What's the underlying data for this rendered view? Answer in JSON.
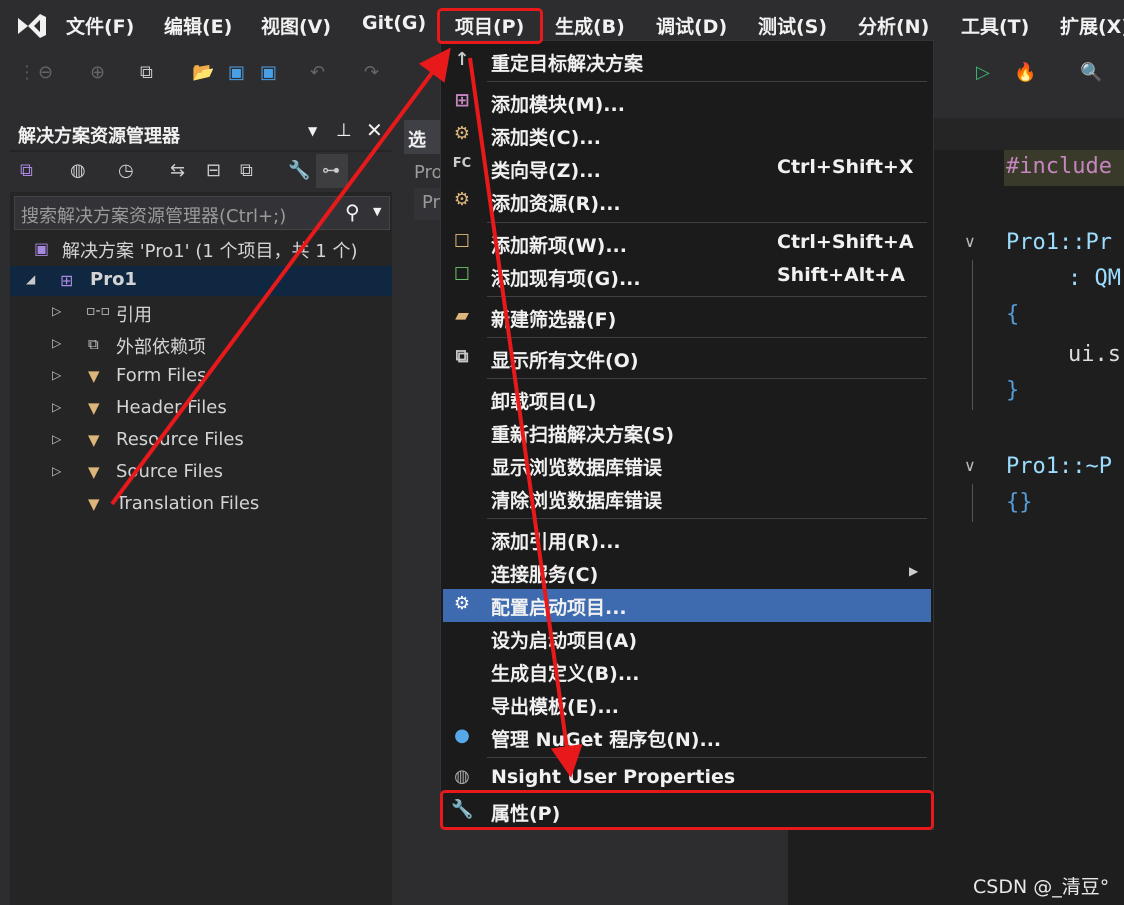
{
  "menubar": {
    "items": [
      "文件(F)",
      "编辑(E)",
      "视图(V)",
      "Git(G)",
      "项目(P)",
      "生成(B)",
      "调试(D)",
      "测试(S)",
      "分析(N)",
      "工具(T)",
      "扩展(X)"
    ]
  },
  "solution_explorer": {
    "title": "解决方案资源管理器",
    "search_placeholder": "搜索解决方案资源管理器(Ctrl+;)",
    "solution": "解决方案 'Pro1' (1 个项目，共 1 个)",
    "project": "Pro1",
    "nodes": [
      "引用",
      "外部依赖项",
      "Form Files",
      "Header Files",
      "Resource Files",
      "Source Files",
      "Translation Files"
    ]
  },
  "middle_panel": {
    "tab": "选",
    "line1": "Pro",
    "line2": "Pr"
  },
  "editor": {
    "lines": [
      "#include",
      "Pro1::Pr",
      ": QM",
      "{",
      "ui.s",
      "}",
      "Pro1::~P",
      "{}"
    ]
  },
  "menu": {
    "items": [
      {
        "label": "重定目标解决方案",
        "shortcut": "",
        "icon": "arrow-up-icon"
      },
      {
        "label": "添加模块(M)...",
        "shortcut": "",
        "icon": "add-module-icon"
      },
      {
        "label": "添加类(C)...",
        "shortcut": "",
        "icon": "add-class-icon"
      },
      {
        "label": "类向导(Z)...",
        "shortcut": "Ctrl+Shift+X",
        "icon": "class-wizard-icon"
      },
      {
        "label": "添加资源(R)...",
        "shortcut": "",
        "icon": "add-resource-icon"
      },
      {
        "label": "添加新项(W)...",
        "shortcut": "Ctrl+Shift+A",
        "icon": "add-new-item-icon"
      },
      {
        "label": "添加现有项(G)...",
        "shortcut": "Shift+Alt+A",
        "icon": "add-existing-item-icon"
      },
      {
        "label": "新建筛选器(F)",
        "shortcut": "",
        "icon": "new-filter-icon"
      },
      {
        "label": "显示所有文件(O)",
        "shortcut": "",
        "icon": "show-all-files-icon"
      },
      {
        "label": "卸载项目(L)",
        "shortcut": "",
        "icon": ""
      },
      {
        "label": "重新扫描解决方案(S)",
        "shortcut": "",
        "icon": ""
      },
      {
        "label": "显示浏览数据库错误",
        "shortcut": "",
        "icon": ""
      },
      {
        "label": "清除浏览数据库错误",
        "shortcut": "",
        "icon": ""
      },
      {
        "label": "添加引用(R)...",
        "shortcut": "",
        "icon": ""
      },
      {
        "label": "连接服务(C)",
        "shortcut": "",
        "icon": ""
      },
      {
        "label": "配置启动项目...",
        "shortcut": "",
        "icon": "gear-icon"
      },
      {
        "label": "设为启动项目(A)",
        "shortcut": "",
        "icon": ""
      },
      {
        "label": "生成自定义(B)...",
        "shortcut": "",
        "icon": ""
      },
      {
        "label": "导出模板(E)...",
        "shortcut": "",
        "icon": ""
      },
      {
        "label": "管理 NuGet 程序包(N)...",
        "shortcut": "",
        "icon": "nuget-icon"
      },
      {
        "label": "Nsight User Properties",
        "shortcut": "",
        "icon": "nsight-icon"
      },
      {
        "label": "属性(P)",
        "shortcut": "",
        "icon": "wrench-icon"
      }
    ]
  },
  "watermark": "CSDN @_清豆°",
  "colors": {
    "highlight": "#3e6ab0",
    "annotation_red": "#e8191a",
    "code_blue": "#9cdcfe",
    "brace_blue": "#569cd6"
  }
}
